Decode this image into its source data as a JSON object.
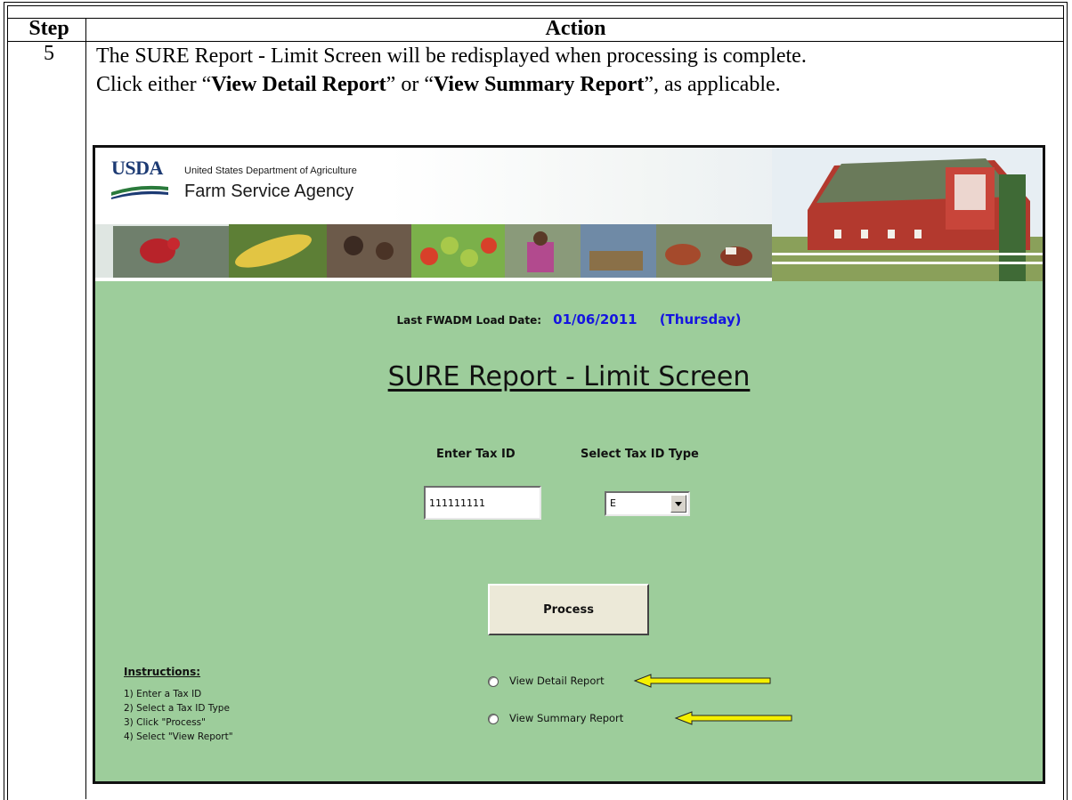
{
  "table": {
    "header_step": "Step",
    "header_action": "Action",
    "step_number": "5",
    "action_line1": "The SURE Report - Limit Screen will be redisplayed when processing is complete.",
    "action_line2_prefix": "Click either “",
    "action_line2_bold1": "View Detail Report",
    "action_line2_mid": "” or “",
    "action_line2_bold2": "View Summary Report",
    "action_line2_suffix": "”, as applicable."
  },
  "banner": {
    "logo_text": "USDA",
    "department": "United States Department of Agriculture",
    "agency": "Farm Service Agency"
  },
  "screen": {
    "load_label": "Last FWADM Load Date:",
    "load_date": "01/06/2011",
    "load_day": "(Thursday)",
    "title": "SURE Report - Limit Screen",
    "tax_id_label": "Enter Tax ID",
    "tax_id_type_label": "Select Tax ID Type",
    "tax_id_value": "111111111",
    "tax_id_type_value": "E",
    "process_label": "Process",
    "instructions_title": "Instructions:",
    "instructions": [
      "1) Enter a Tax ID",
      "2) Select a Tax ID Type",
      "3) Click \"Process\"",
      "4) Select \"View Report\""
    ],
    "radio_detail": "View Detail Report",
    "radio_summary": "View Summary Report"
  },
  "colors": {
    "screen_background": "#9dcd9b",
    "date_text": "#1515e0",
    "arrow_fill": "#f5f000"
  },
  "icons": [
    "dropdown-arrow-icon",
    "pointer-arrow-icon",
    "radio-icon"
  ]
}
